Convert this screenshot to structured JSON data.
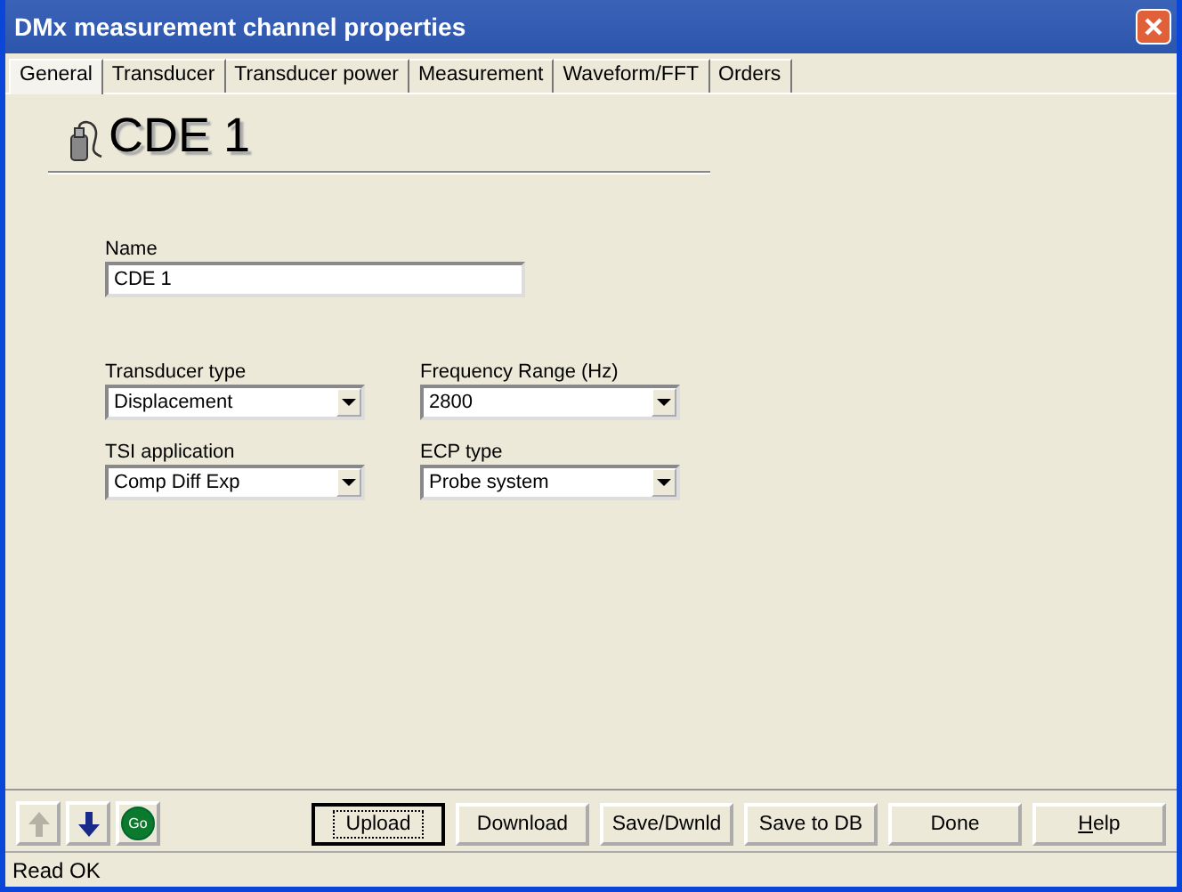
{
  "window": {
    "title": "DMx measurement channel properties"
  },
  "tabs": [
    {
      "label": "General",
      "selected": true
    },
    {
      "label": "Transducer",
      "selected": false
    },
    {
      "label": "Transducer power",
      "selected": false
    },
    {
      "label": "Measurement",
      "selected": false
    },
    {
      "label": "Waveform/FFT",
      "selected": false
    },
    {
      "label": "Orders",
      "selected": false
    }
  ],
  "heading": "CDE 1",
  "name_field": {
    "label": "Name",
    "value": "CDE 1"
  },
  "dropdowns": [
    {
      "label": "Transducer type",
      "value": "Displacement"
    },
    {
      "label": "Frequency Range (Hz)",
      "value": "2800"
    },
    {
      "label": "TSI application",
      "value": "Comp Diff Exp"
    },
    {
      "label": "ECP type",
      "value": "Probe system"
    }
  ],
  "nav_buttons": [
    {
      "kind": "up",
      "disabled": true
    },
    {
      "kind": "down",
      "disabled": false
    },
    {
      "kind": "go",
      "label": "Go",
      "disabled": false
    }
  ],
  "buttons": [
    {
      "label": "Upload",
      "focused": true
    },
    {
      "label": "Download",
      "focused": false
    },
    {
      "label": "Save/Dwnld",
      "focused": false
    },
    {
      "label": "Save to DB",
      "focused": false
    },
    {
      "label": "Done",
      "focused": false
    },
    {
      "label": "Help",
      "focused": false,
      "first_letter_underlined": true
    }
  ],
  "status_bar": "Read OK"
}
